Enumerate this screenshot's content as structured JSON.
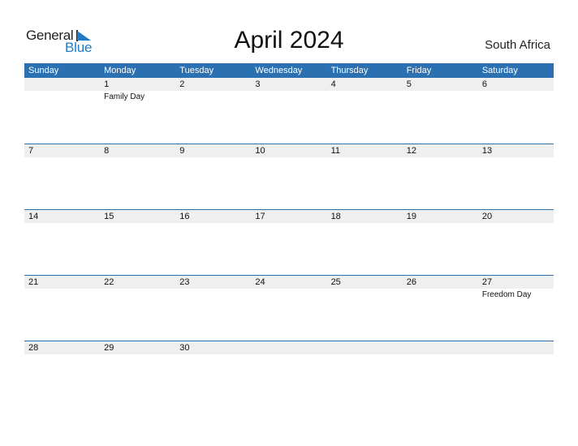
{
  "logo": {
    "line1": "General",
    "line2": "Blue"
  },
  "title": "April 2024",
  "country": "South Africa",
  "colors": {
    "header_bg": "#2b71b1",
    "band_bg": "#efefef",
    "logo_blue": "#1f7bc7"
  },
  "weekdays": [
    "Sunday",
    "Monday",
    "Tuesday",
    "Wednesday",
    "Thursday",
    "Friday",
    "Saturday"
  ],
  "weeks": [
    [
      {
        "day": ""
      },
      {
        "day": "1",
        "holiday": "Family Day"
      },
      {
        "day": "2"
      },
      {
        "day": "3"
      },
      {
        "day": "4"
      },
      {
        "day": "5"
      },
      {
        "day": "6"
      }
    ],
    [
      {
        "day": "7"
      },
      {
        "day": "8"
      },
      {
        "day": "9"
      },
      {
        "day": "10"
      },
      {
        "day": "11"
      },
      {
        "day": "12"
      },
      {
        "day": "13"
      }
    ],
    [
      {
        "day": "14"
      },
      {
        "day": "15"
      },
      {
        "day": "16"
      },
      {
        "day": "17"
      },
      {
        "day": "18"
      },
      {
        "day": "19"
      },
      {
        "day": "20"
      }
    ],
    [
      {
        "day": "21"
      },
      {
        "day": "22"
      },
      {
        "day": "23"
      },
      {
        "day": "24"
      },
      {
        "day": "25"
      },
      {
        "day": "26"
      },
      {
        "day": "27",
        "holiday": "Freedom Day"
      }
    ],
    [
      {
        "day": "28"
      },
      {
        "day": "29"
      },
      {
        "day": "30"
      },
      {
        "day": ""
      },
      {
        "day": ""
      },
      {
        "day": ""
      },
      {
        "day": ""
      }
    ]
  ]
}
